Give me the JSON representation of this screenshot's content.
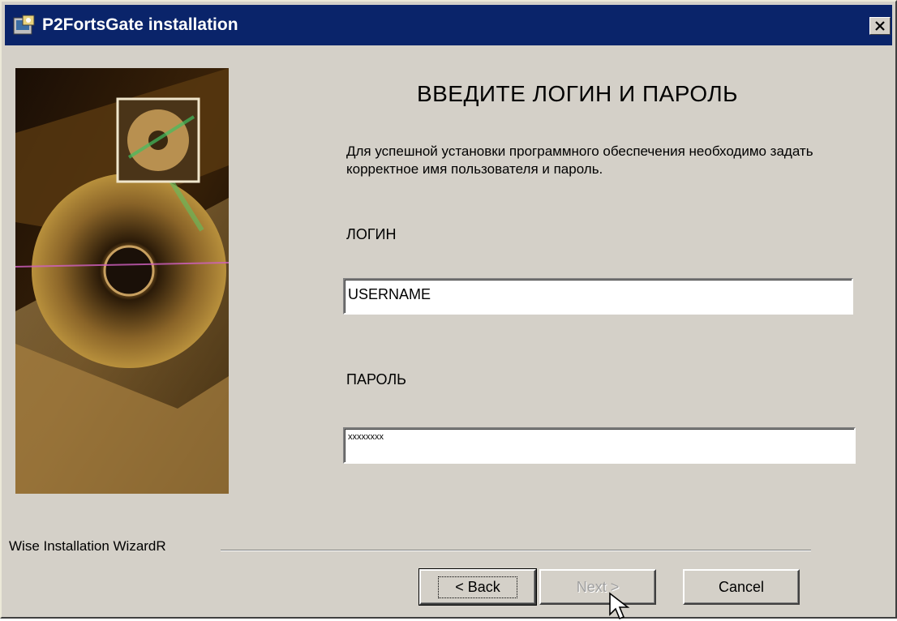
{
  "window": {
    "title": "P2FortsGate installation"
  },
  "main": {
    "heading": "ВВЕДИТЕ ЛОГИН И ПАРОЛЬ",
    "description": "Для успешной установки программного обеспечения необходимо задать корректное имя пользователя и пароль.",
    "login_label": "ЛОГИН",
    "login_value": "USERNAME",
    "password_label": "ПАРОЛЬ",
    "password_value": "xxxxxxxx"
  },
  "footer": {
    "wizard_label": "Wise Installation WizardR",
    "back_label": "< Back",
    "next_label": "Next >",
    "cancel_label": "Cancel"
  },
  "icons": [
    "app-icon",
    "close-icon",
    "banner-image",
    "mouse-cursor"
  ],
  "colors": {
    "titlebar": "#0a246a",
    "dialog": "#d4d0c8"
  }
}
